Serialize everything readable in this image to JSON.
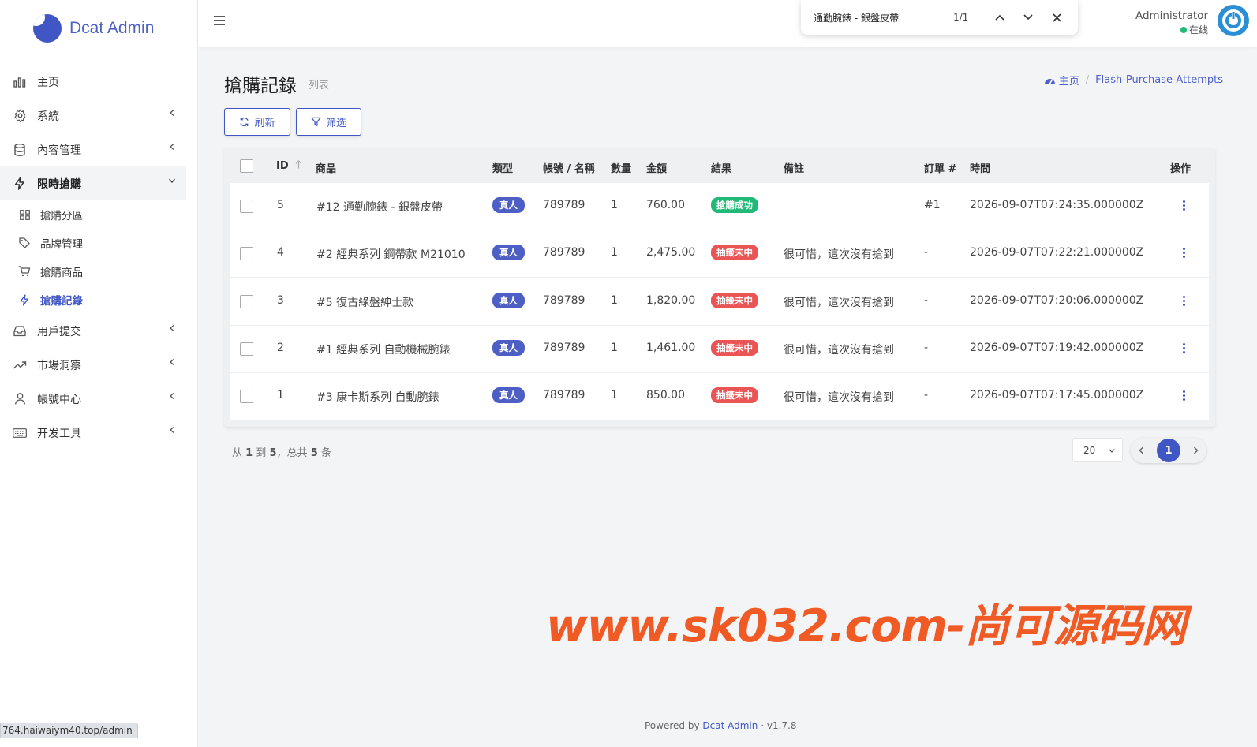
{
  "app": {
    "name": "Dcat Admin"
  },
  "find_bar": {
    "query": "通勤腕錶 - 銀盤皮帶",
    "count": "1/1"
  },
  "user": {
    "name": "Administrator",
    "status": "在线"
  },
  "sidebar": {
    "items": [
      {
        "label": "主页",
        "icon": "bar-chart-icon"
      },
      {
        "label": "系統",
        "icon": "gear-icon"
      },
      {
        "label": "內容管理",
        "icon": "database-icon"
      },
      {
        "label": "限時搶購",
        "icon": "lightning-icon"
      },
      {
        "label": "用戶提交",
        "icon": "inbox-icon"
      },
      {
        "label": "市場洞察",
        "icon": "trend-icon"
      },
      {
        "label": "帳號中心",
        "icon": "user-icon"
      },
      {
        "label": "开发工具",
        "icon": "keyboard-icon"
      }
    ],
    "subitems": [
      {
        "label": "搶購分區",
        "icon": "grid-icon"
      },
      {
        "label": "品牌管理",
        "icon": "tag-icon"
      },
      {
        "label": "搶購商品",
        "icon": "cart-icon"
      },
      {
        "label": "搶購記錄",
        "icon": "lightning-icon"
      }
    ]
  },
  "page": {
    "title": "搶購記錄",
    "subtitle": "列表",
    "breadcrumb": {
      "home": "主页",
      "current": "Flash-Purchase-Attempts"
    },
    "refresh_label": "刷新",
    "filter_label": "筛选"
  },
  "table": {
    "headers": {
      "id": "ID",
      "product": "商品",
      "type": "類型",
      "account": "帳號 / 名稱",
      "qty": "數量",
      "amount": "金額",
      "result": "結果",
      "note": "備註",
      "order": "訂單 #",
      "time": "時間",
      "action": "操作"
    },
    "rows": [
      {
        "id": "5",
        "product": "#12 通勤腕錶 - 銀盤皮帶",
        "type": "真人",
        "account": "789789",
        "qty": "1",
        "amount": "760.00",
        "result": "搶購成功",
        "result_kind": "success",
        "note": "",
        "order": "#1",
        "time": "2026-09-07T07:24:35.000000Z"
      },
      {
        "id": "4",
        "product": "#2 經典系列 鋼帶款 M21010",
        "type": "真人",
        "account": "789789",
        "qty": "1",
        "amount": "2,475.00",
        "result": "抽籤未中",
        "result_kind": "fail",
        "note": "很可惜，這次沒有搶到",
        "order": "-",
        "time": "2026-09-07T07:22:21.000000Z"
      },
      {
        "id": "3",
        "product": "#5 復古綠盤紳士款",
        "type": "真人",
        "account": "789789",
        "qty": "1",
        "amount": "1,820.00",
        "result": "抽籤未中",
        "result_kind": "fail",
        "note": "很可惜，這次沒有搶到",
        "order": "-",
        "time": "2026-09-07T07:20:06.000000Z"
      },
      {
        "id": "2",
        "product": "#1 經典系列 自動機械腕錶",
        "type": "真人",
        "account": "789789",
        "qty": "1",
        "amount": "1,461.00",
        "result": "抽籤未中",
        "result_kind": "fail",
        "note": "很可惜，這次沒有搶到",
        "order": "-",
        "time": "2026-09-07T07:19:42.000000Z"
      },
      {
        "id": "1",
        "product": "#3 康卡斯系列 自動腕錶",
        "type": "真人",
        "account": "789789",
        "qty": "1",
        "amount": "850.00",
        "result": "抽籤未中",
        "result_kind": "fail",
        "note": "很可惜，這次沒有搶到",
        "order": "-",
        "time": "2026-09-07T07:17:45.000000Z"
      }
    ]
  },
  "summary": {
    "prefix": "从",
    "from": "1",
    "mid": "到",
    "to": "5",
    "sep": "，总共",
    "total": "5",
    "suffix": "条"
  },
  "pagination": {
    "per_page": "20",
    "current": "1"
  },
  "watermark": "www.sk032.com-尚可源码网",
  "footer": {
    "prefix": "Powered by",
    "link": "Dcat Admin",
    "sep": "·",
    "version": "v1.7.8"
  },
  "status_url": "764.haiwaiym40.top/admin",
  "colors": {
    "primary": "#4056c4",
    "success": "#21b978",
    "danger": "#ea5455",
    "watermark": "#f05a24"
  }
}
